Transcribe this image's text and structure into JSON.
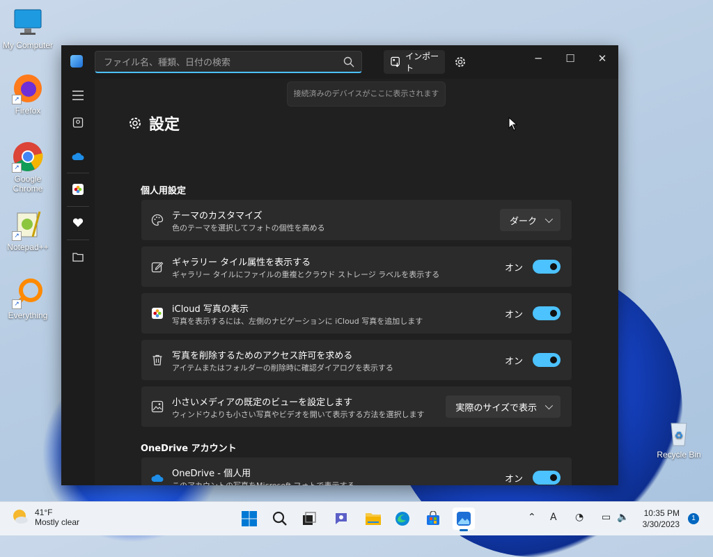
{
  "desktop": {
    "icons": [
      {
        "label": "My Computer"
      },
      {
        "label": "Firefox"
      },
      {
        "label": "Google Chrome"
      },
      {
        "label": "Notepad++"
      },
      {
        "label": "Everything"
      },
      {
        "label": "Recycle Bin"
      }
    ]
  },
  "window": {
    "search_placeholder": "ファイル名、種類、日付の検索",
    "import_label": "インポート",
    "device_tip": "接続済みのデバイスがここに表示されます",
    "controls": {
      "minimize": "─",
      "maximize": "☐",
      "close": "✕"
    }
  },
  "settings": {
    "page_title": "設定",
    "personal_section": "個人用設定",
    "onedrive_section": "OneDrive アカウント",
    "cards": [
      {
        "title": "テーマのカスタマイズ",
        "subtitle": "色のテーマを選択してフォトの個性を高める",
        "control": "dropdown",
        "value": "ダーク"
      },
      {
        "title": "ギャラリー タイル属性を表示する",
        "subtitle": "ギャラリー タイルにファイルの重複とクラウド ストレージ ラベルを表示する",
        "control": "toggle",
        "value": "オン"
      },
      {
        "title": "iCloud 写真の表示",
        "subtitle": "写真を表示するには、左側のナビゲーションに iCloud 写真を追加します",
        "control": "toggle",
        "value": "オン"
      },
      {
        "title": "写真を削除するためのアクセス許可を求める",
        "subtitle": "アイテムまたはフォルダーの削除時に確認ダイアログを表示する",
        "control": "toggle",
        "value": "オン"
      },
      {
        "title": "小さいメディアの既定のビューを設定します",
        "subtitle": "ウィンドウよりも小さい写真やビデオを開いて表示する方法を選択します",
        "control": "dropdown",
        "value": "実際のサイズで表示"
      },
      {
        "title": "OneDrive - 個人用",
        "subtitle": "このアカウントの写真をMicrosoft フォトで表示する",
        "control": "toggle",
        "value": "オン"
      }
    ]
  },
  "taskbar": {
    "weather_temp": "41°F",
    "weather_desc": "Mostly clear",
    "time": "10:35 PM",
    "date": "3/30/2023",
    "notification_count": "1",
    "ime_label": "A"
  },
  "colors": {
    "accent": "#4cc2ff",
    "window_bg": "#202020",
    "card_bg": "#2b2b2b",
    "taskbar_accent": "#0067c0"
  }
}
